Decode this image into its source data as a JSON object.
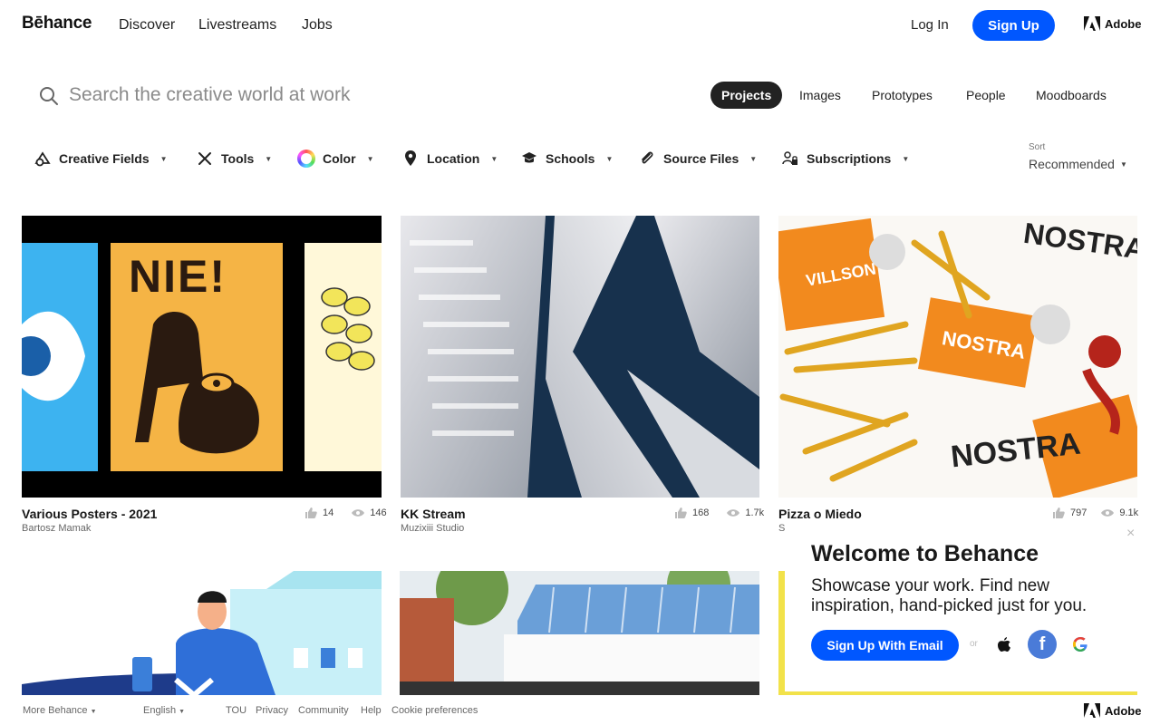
{
  "nav": {
    "logo": "Bēhance",
    "links": [
      "Discover",
      "Livestreams",
      "Jobs"
    ],
    "login": "Log In",
    "signup": "Sign Up",
    "adobe": "Adobe"
  },
  "search": {
    "placeholder": "Search the creative world at work",
    "value": "",
    "tabs": [
      "Projects",
      "Images",
      "Prototypes",
      "People",
      "Moodboards"
    ],
    "active_tab": "Projects"
  },
  "filters": {
    "items": [
      "Creative Fields",
      "Tools",
      "Color",
      "Location",
      "Schools",
      "Source Files",
      "Subscriptions"
    ],
    "sort_label": "Sort",
    "sort_value": "Recommended"
  },
  "projects": [
    {
      "title": "Various Posters - 2021",
      "owner": "Bartosz Mamak",
      "likes": "14",
      "views": "146"
    },
    {
      "title": "KK Stream",
      "owner": "Muzixiii Studio",
      "likes": "168",
      "views": "1.7k"
    },
    {
      "title": "Pizza o Miedo",
      "owner": "S",
      "likes": "797",
      "views": "9.1k"
    }
  ],
  "thumb_text": {
    "poster_title": "NIE!",
    "brand": "NOSTRA",
    "brand_alt": "VILLSON"
  },
  "welcome": {
    "close": "×",
    "title": "Welcome to Behance",
    "text": "Showcase your work. Find new inspiration, hand-picked just for you.",
    "email_button": "Sign Up With Email",
    "or": "or"
  },
  "footer": {
    "more": "More Behance",
    "language": "English",
    "links": [
      "TOU",
      "Privacy",
      "Community",
      "Help",
      "Cookie preferences"
    ],
    "adobe": "Adobe"
  },
  "colors": {
    "brand_blue": "#0057ff",
    "active_tab_bg": "#222222",
    "facebook": "#4a7bd8"
  }
}
